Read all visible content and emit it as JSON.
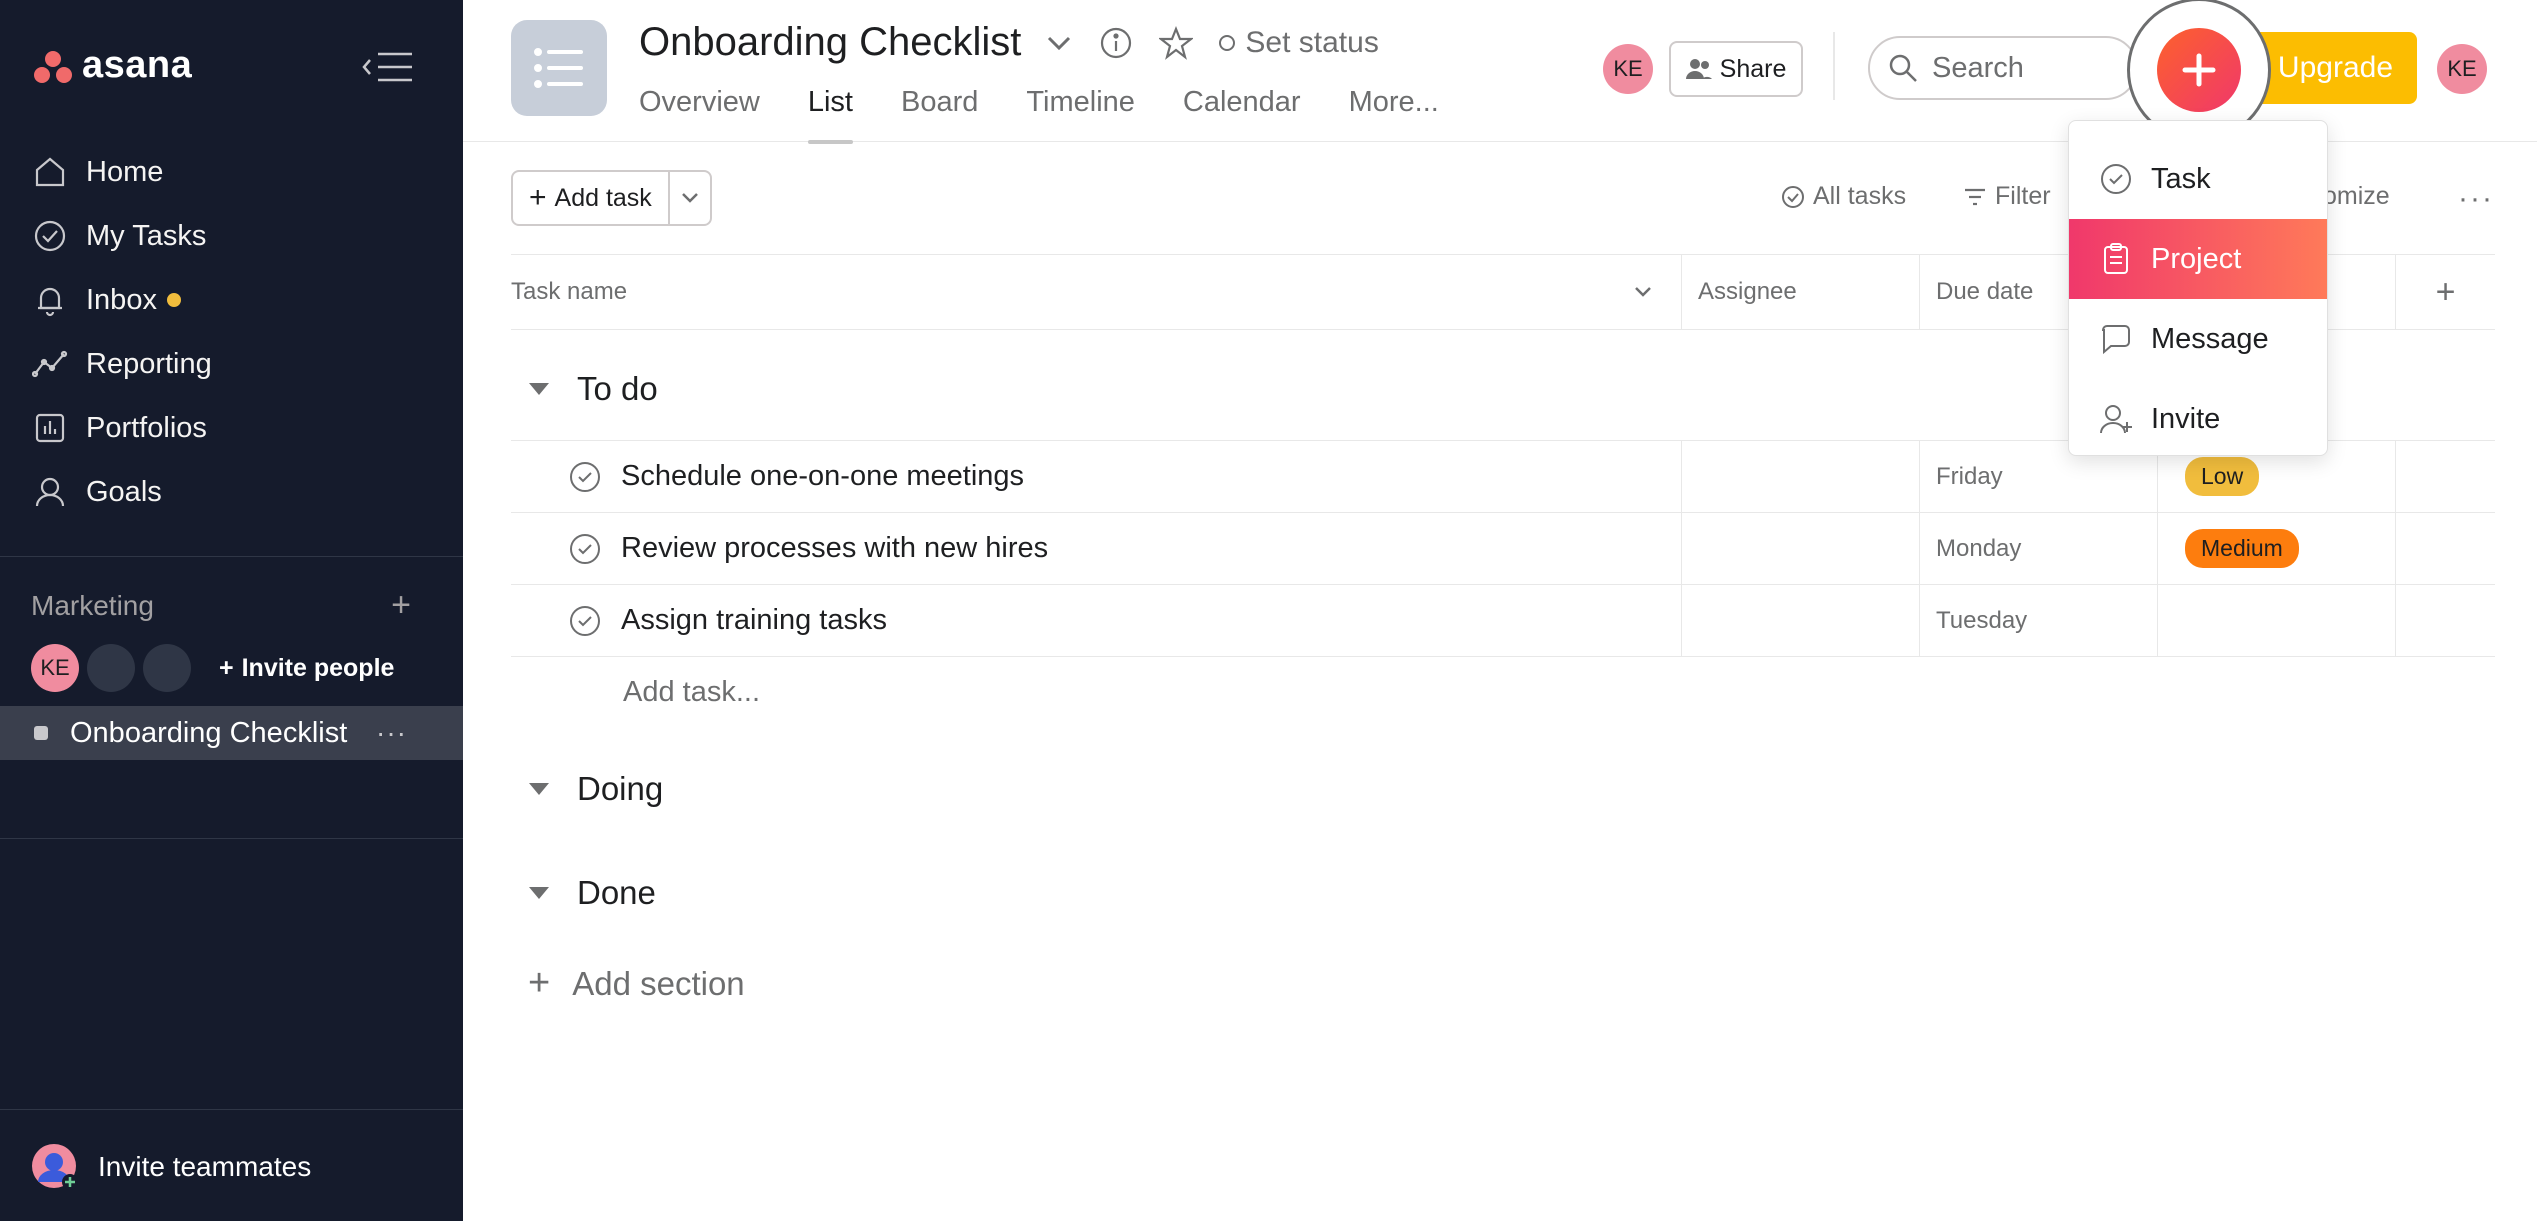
{
  "brand": {
    "name": "asana"
  },
  "sidebar": {
    "nav": [
      {
        "label": "Home",
        "icon": "home-icon"
      },
      {
        "label": "My Tasks",
        "icon": "check-circle-icon"
      },
      {
        "label": "Inbox",
        "icon": "bell-icon"
      },
      {
        "label": "Reporting",
        "icon": "trend-line-icon"
      },
      {
        "label": "Portfolios",
        "icon": "bar-chart-icon"
      },
      {
        "label": "Goals",
        "icon": "person-icon"
      }
    ],
    "team": {
      "name": "Marketing",
      "avatar_initials": "KE",
      "invite_label": "Invite people"
    },
    "project": {
      "name": "Onboarding Checklist",
      "more": "···"
    },
    "invite_teammates": "Invite teammates"
  },
  "header": {
    "title": "Onboarding Checklist",
    "set_status": "Set status",
    "tabs": [
      "Overview",
      "List",
      "Board",
      "Timeline",
      "Calendar",
      "More..."
    ],
    "active_tab": "List",
    "avatar_initials": "KE",
    "share_label": "Share",
    "search_placeholder": "Search",
    "upgrade_label": "Upgrade"
  },
  "toolbar": {
    "add_task_label": "Add task",
    "all_tasks_label": "All tasks",
    "filter_label": "Filter",
    "customize_partial": "omize",
    "more": "···"
  },
  "table": {
    "columns": [
      "Task name",
      "Assignee",
      "Due date"
    ],
    "sections": [
      {
        "name": "To do",
        "tasks": [
          {
            "name": "Schedule one-on-one meetings",
            "due": "Friday",
            "priority": "Low"
          },
          {
            "name": "Review processes with new hires",
            "due": "Monday",
            "priority": "Medium"
          },
          {
            "name": "Assign training tasks",
            "due": "Tuesday",
            "priority": ""
          }
        ],
        "add_task": "Add task..."
      },
      {
        "name": "Doing"
      },
      {
        "name": "Done"
      }
    ],
    "add_section": "Add section"
  },
  "quick_add_menu": {
    "items": [
      {
        "label": "Task",
        "icon": "check-circle-icon"
      },
      {
        "label": "Project",
        "icon": "clipboard-icon"
      },
      {
        "label": "Message",
        "icon": "speech-bubble-icon"
      },
      {
        "label": "Invite",
        "icon": "add-person-icon"
      }
    ],
    "highlighted": "Project"
  },
  "colors": {
    "sidebar_bg": "#151b2c",
    "brand_coral": "#f06a6a",
    "upgrade_yellow": "#fcbd01",
    "priority_low": "#f1bd3d",
    "priority_medium": "#fd7d0e",
    "plus_gradient_start": "#fd612c",
    "plus_gradient_end": "#f0386b"
  }
}
